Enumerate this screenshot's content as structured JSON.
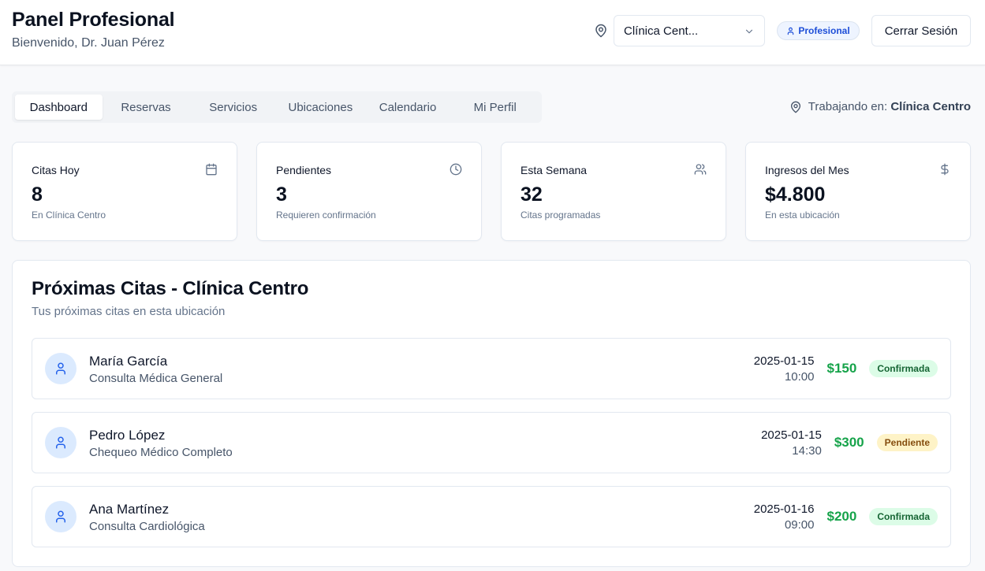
{
  "header": {
    "title": "Panel Profesional",
    "subtitle": "Bienvenido, Dr. Juan Pérez",
    "location_select": "Clínica Cent...",
    "role_badge": "Profesional",
    "logout_label": "Cerrar Sesión"
  },
  "tabs": [
    {
      "label": "Dashboard"
    },
    {
      "label": "Reservas"
    },
    {
      "label": "Servicios"
    },
    {
      "label": "Ubicaciones"
    },
    {
      "label": "Calendario"
    },
    {
      "label": "Mi Perfil"
    }
  ],
  "working": {
    "prefix": "Trabajando en:",
    "location": "Clínica Centro"
  },
  "stats": [
    {
      "label": "Citas Hoy",
      "value": "8",
      "note": "En Clínica Centro",
      "icon": "calendar-icon"
    },
    {
      "label": "Pendientes",
      "value": "3",
      "note": "Requieren confirmación",
      "icon": "clock-icon"
    },
    {
      "label": "Esta Semana",
      "value": "32",
      "note": "Citas programadas",
      "icon": "users-icon"
    },
    {
      "label": "Ingresos del Mes",
      "value": "$4.800",
      "note": "En esta ubicación",
      "icon": "dollar-icon"
    }
  ],
  "appointments": {
    "title": "Próximas Citas - Clínica Centro",
    "subtitle": "Tus próximas citas en esta ubicación",
    "items": [
      {
        "name": "María García",
        "service": "Consulta Médica General",
        "date": "2025-01-15",
        "time": "10:00",
        "price": "$150",
        "status": "Confirmada"
      },
      {
        "name": "Pedro López",
        "service": "Chequeo Médico Completo",
        "date": "2025-01-15",
        "time": "14:30",
        "price": "$300",
        "status": "Pendiente"
      },
      {
        "name": "Ana Martínez",
        "service": "Consulta Cardiológica",
        "date": "2025-01-16",
        "time": "09:00",
        "price": "$200",
        "status": "Confirmada"
      }
    ]
  },
  "colors": {
    "accent_blue": "#1d4ed8",
    "price_green": "#16a34a",
    "confirmed_bg": "#dcfce7",
    "pending_bg": "#fef3c7"
  }
}
